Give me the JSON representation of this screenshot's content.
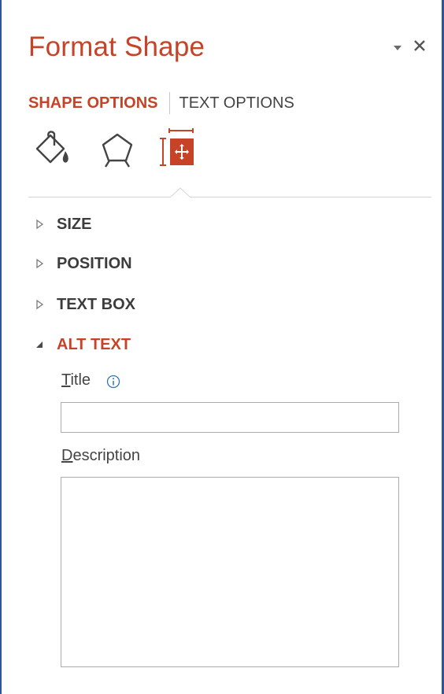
{
  "pane": {
    "title": "Format Shape",
    "options_icon": "dropdown-triangle-icon",
    "close_glyph": "✕",
    "accent_color": "#c64328",
    "border_color": "#2b579a"
  },
  "tabs": [
    {
      "label": "SHAPE OPTIONS",
      "active": true
    },
    {
      "label": "TEXT OPTIONS",
      "active": false
    }
  ],
  "category_icons": [
    {
      "name": "fill-line-icon",
      "active": false
    },
    {
      "name": "effects-icon",
      "active": false
    },
    {
      "name": "size-properties-icon",
      "active": true
    }
  ],
  "sections": [
    {
      "label": "SIZE",
      "expanded": false
    },
    {
      "label": "POSITION",
      "expanded": false
    },
    {
      "label": "TEXT BOX",
      "expanded": false
    },
    {
      "label": "ALT TEXT",
      "expanded": true
    }
  ],
  "alt_text": {
    "title_label_mnemonic": "T",
    "title_label_rest": "itle",
    "title_value": "",
    "info_icon": "info-icon",
    "description_label_mnemonic": "D",
    "description_label_rest": "escription",
    "description_value": ""
  }
}
